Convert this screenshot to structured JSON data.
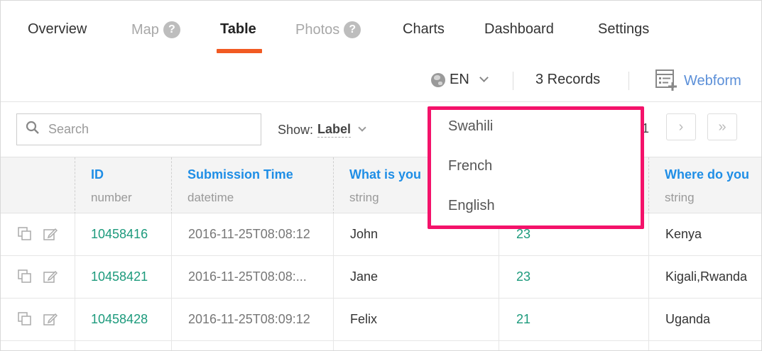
{
  "tabs": [
    {
      "label": "Overview",
      "help": false,
      "state": "normal"
    },
    {
      "label": "Map",
      "help": true,
      "state": "muted"
    },
    {
      "label": "Table",
      "help": false,
      "state": "active"
    },
    {
      "label": "Photos",
      "help": true,
      "state": "muted"
    },
    {
      "label": "Charts",
      "help": false,
      "state": "normal"
    },
    {
      "label": "Dashboard",
      "help": false,
      "state": "normal"
    },
    {
      "label": "Settings",
      "help": false,
      "state": "normal"
    }
  ],
  "help_glyph": "?",
  "toolbar": {
    "language": "EN",
    "records": "3 Records",
    "webform_label": "Webform"
  },
  "search": {
    "placeholder": "Search",
    "value": ""
  },
  "show": {
    "label": "Show:",
    "value": "Label"
  },
  "pagination": {
    "page": "1",
    "next_glyph": "›",
    "last_glyph": "»"
  },
  "table": {
    "columns": [
      {
        "name": "ID",
        "type": "number"
      },
      {
        "name": "Submission Time",
        "type": "datetime"
      },
      {
        "name": "What is you",
        "type": "string"
      },
      {
        "name": "",
        "type": ""
      },
      {
        "name": "Where do you",
        "type": "string"
      }
    ],
    "rows": [
      {
        "id": "10458416",
        "time": "2016-11-25T08:08:12",
        "name": "John",
        "age": "23",
        "place": "Kenya"
      },
      {
        "id": "10458421",
        "time": "2016-11-25T08:08:...",
        "name": "Jane",
        "age": "23",
        "place": "Kigali,Rwanda"
      },
      {
        "id": "10458428",
        "time": "2016-11-25T08:09:12",
        "name": "Felix",
        "age": "21",
        "place": "Uganda"
      }
    ]
  },
  "language_dropdown": {
    "options": [
      "Swahili",
      "French",
      "English"
    ],
    "border_color": "#f4126a"
  },
  "colors": {
    "accent": "#f15a22",
    "link": "#1f8ee6",
    "id_green": "#1c9a7c",
    "webform": "#5b8fd8"
  }
}
